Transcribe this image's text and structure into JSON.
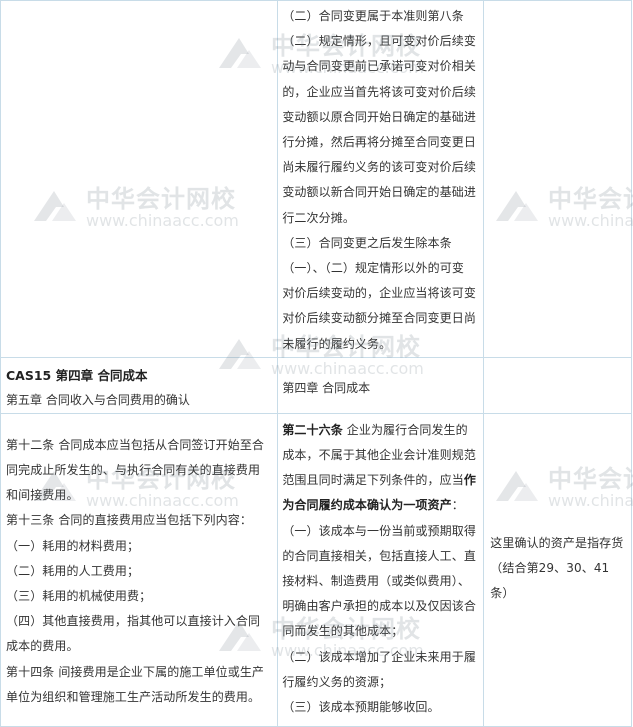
{
  "rows": {
    "top": {
      "middle": [
        "（二）合同变更属于本准则第八条",
        "（二）规定情形，且可变对价后续变",
        "动与合同变更前已承诺可变对价相关",
        "的，企业应当首先将该可变对价后续",
        "变动额以原合同开始日确定的基础进",
        "行分摊，然后再将分摊至合同变更日",
        "尚未履行履约义务的该可变对价后续",
        "变动额以新合同开始日确定的基础进",
        "行二次分摊。",
        "（三）合同变更之后发生除本条",
        "（一）、（二）规定情形以外的可变",
        "对价后续变动的，企业应当将该可变",
        "对价后续变动额分摊至合同变更日尚",
        "未履行的履约义务。"
      ]
    },
    "chapter": {
      "left_title": "CAS15 第四章 合同成本",
      "left_sub": "第五章 合同收入与合同费用的确认",
      "middle": "第四章 合同成本"
    },
    "bottom": {
      "left": [
        "第十二条 合同成本应当包括从合同签订开始至合",
        "同完成止所发生的、与执行合同有关的直接费用",
        "和间接费用。",
        "第十三条 合同的直接费用应当包括下列内容：",
        "（一）耗用的材料费用；",
        "（二）耗用的人工费用；",
        "（三）耗用的机械使用费；",
        "（四）其他直接费用，指其他可以直接计入合同",
        "成本的费用。",
        "第十四条 间接费用是企业下属的施工单位或生产",
        "单位为组织和管理施工生产活动所发生的费用。"
      ],
      "middle_article": "第二十六条",
      "middle_first": " 企业为履行合同发生的",
      "middle_lines_a": [
        "成本，不属于其他企业会计准则规范",
        "范围且同时满足下列条件的，应当"
      ],
      "middle_bold_1": "作",
      "middle_bold_2": "为合同履约成本确认为一项资产",
      "middle_colon": "：",
      "middle_lines_b": [
        "（一）该成本与一份当前或预期取得",
        "的合同直接相关，包括直接人工、直",
        "接材料、制造费用（或类似费用）、",
        "明确由客户承担的成本以及仅因该合",
        "同而发生的其他成本；",
        "（二）该成本增加了企业未来用于履",
        "行履约义务的资源；",
        "（三）该成本预期能够收回。"
      ],
      "right": [
        "这里确认的资产是指存货",
        "（结合第29、30、41",
        "条）"
      ]
    }
  },
  "watermark": {
    "cn": "中华会计网校",
    "url": "www.chinaacc.com"
  },
  "colors": {
    "border": "#c8dce8",
    "text": "#333333",
    "watermark": "#7a828c"
  }
}
